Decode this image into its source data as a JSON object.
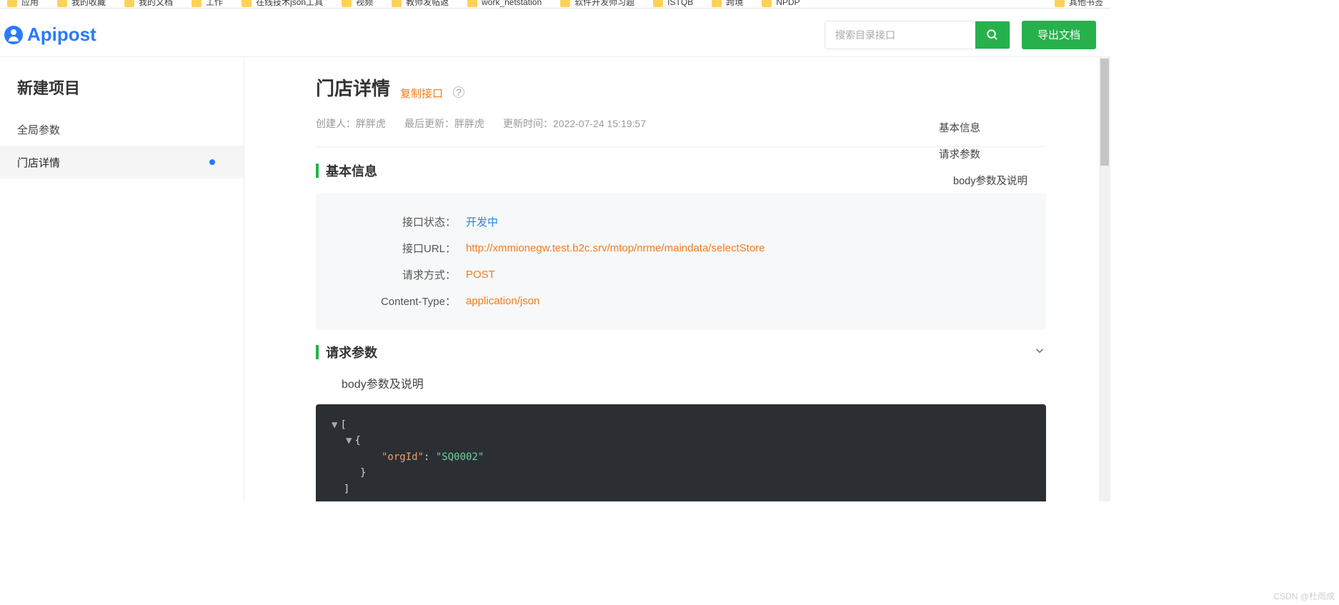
{
  "bookmarks": {
    "left": [
      "应用",
      "我的收藏",
      "我的文档",
      "工作",
      "在线技术json工具",
      "视频",
      "教师发帖返",
      "work_netstation",
      "软件开发师习题",
      "ISTQB",
      "跨境",
      "NPDP"
    ],
    "right": "其他书签"
  },
  "brand": "Apipost",
  "header": {
    "search_placeholder": "搜索目录接口",
    "export_label": "导出文档"
  },
  "sidebar": {
    "title": "新建项目",
    "items": [
      {
        "label": "全局参数",
        "active": false
      },
      {
        "label": "门店详情",
        "active": true
      }
    ]
  },
  "page": {
    "title": "门店详情",
    "copy_label": "复制接口",
    "meta": {
      "creator_label": "创建人：",
      "creator": "胖胖虎",
      "updater_label": "最后更新：",
      "updater": "胖胖虎",
      "updated_label": "更新时间：",
      "updated_at": "2022-07-24 15:19:57"
    }
  },
  "sections": {
    "basic_title": "基本信息",
    "request_title": "请求参数",
    "body_sub_title": "body参数及说明"
  },
  "basic_info": {
    "rows": [
      {
        "label": "接口状态：",
        "value": "开发中",
        "link": true
      },
      {
        "label": "接口URL：",
        "value": "http://xmmionegw.test.b2c.srv/mtop/nrme/maindata/selectStore",
        "link": false
      },
      {
        "label": "请求方式：",
        "value": "POST",
        "link": false
      },
      {
        "label": "Content-Type：",
        "value": "application/json",
        "link": false
      }
    ]
  },
  "body_json": {
    "key": "\"orgId\"",
    "value": "\"SQ0002\""
  },
  "toc": {
    "items": [
      {
        "label": "基本信息",
        "sub": false
      },
      {
        "label": "请求参数",
        "sub": false
      },
      {
        "label": "body参数及说明",
        "sub": true
      }
    ]
  },
  "watermark": "CSDN @杜雨成"
}
